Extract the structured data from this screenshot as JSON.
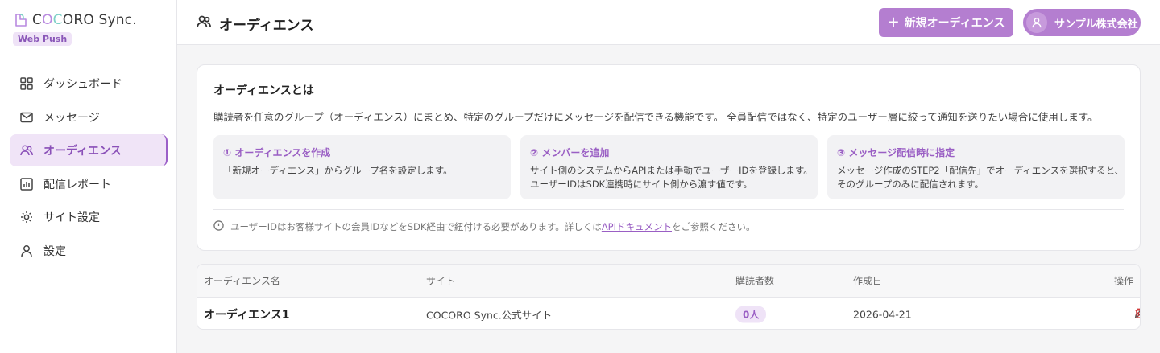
{
  "brand": {
    "name_part1": "C",
    "name_part2": "O",
    "name_part3": "C",
    "name_part4": "ORO Sync.",
    "badge": "Web Push"
  },
  "sidebar": {
    "items": [
      {
        "label": "ダッシュボード",
        "icon": "dashboard-icon"
      },
      {
        "label": "メッセージ",
        "icon": "mail-icon"
      },
      {
        "label": "オーディエンス",
        "icon": "users-icon",
        "active": true
      },
      {
        "label": "配信レポート",
        "icon": "report-icon"
      },
      {
        "label": "サイト設定",
        "icon": "gear-icon"
      },
      {
        "label": "設定",
        "icon": "user-icon"
      }
    ]
  },
  "header": {
    "title": "オーディエンス",
    "new_button": "新規オーディエンス",
    "account": "サンプル株式会社"
  },
  "info": {
    "title": "オーディエンスとは",
    "description": "購読者を任意のグループ（オーディエンス）にまとめ、特定のグループだけにメッセージを配信できる機能です。 全員配信ではなく、特定のユーザー層に絞って通知を送りたい場合に使用します。",
    "steps": [
      {
        "title": "① オーディエンスを作成",
        "line1": "「新規オーディエンス」からグループ名を設定します。",
        "line2": ""
      },
      {
        "title": "② メンバーを追加",
        "line1": "サイト側のシステムからAPIまたは手動でユーザーIDを登録します。",
        "line2": "ユーザーIDはSDK連携時にサイト側から渡す値です。"
      },
      {
        "title": "③ メッセージ配信時に指定",
        "line1": "メッセージ作成のSTEP2「配信先」でオーディエンスを選択すると、",
        "line2": "そのグループのみに配信されます。"
      }
    ],
    "note_before": "ユーザーIDはお客様サイトの会員IDなどをSDK経由で紐付ける必要があります。詳しくは",
    "note_link": "APIドキュメント",
    "note_after": "をご参照ください。"
  },
  "table": {
    "columns": [
      "オーディエンス名",
      "サイト",
      "購読者数",
      "作成日",
      "操作"
    ],
    "rows": [
      {
        "name": "オーディエンス1",
        "site": "COCORO Sync.公式サイト",
        "subscribers": "0人",
        "created": "2026-04-21"
      }
    ]
  },
  "colors": {
    "accent": "#b47ed0",
    "accent_text": "#9a5fc4",
    "danger": "#d13a3a"
  }
}
